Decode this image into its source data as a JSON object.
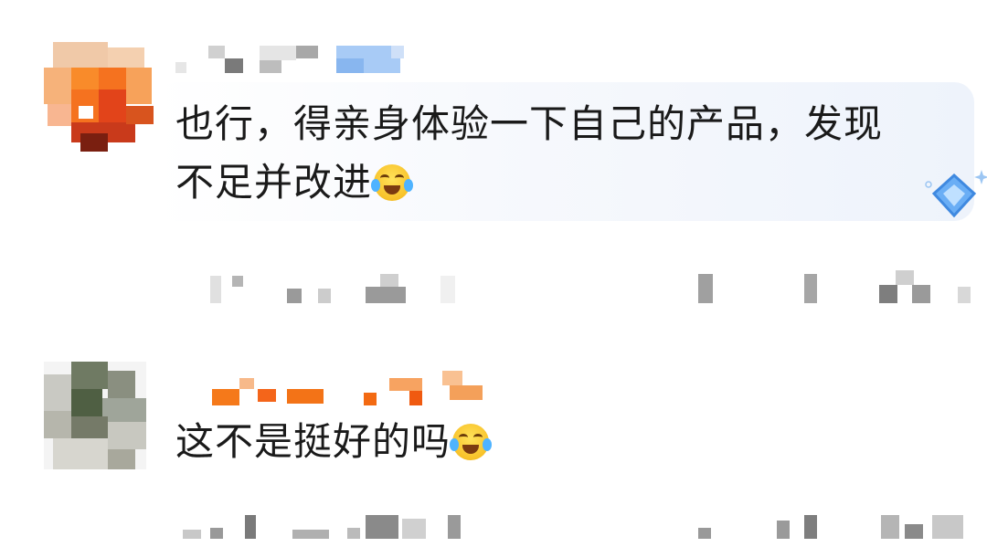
{
  "comments": [
    {
      "text_line1": "也行，得亲身体验一下自己的产品，发现",
      "text_line2": "不足并改进",
      "emoji": "crying-laughing-emoji"
    },
    {
      "text_line1": "这不是挺好的吗",
      "emoji": "crying-laughing-emoji"
    }
  ],
  "colors": {
    "bubble_bg": "#eef3fb",
    "text": "#1a1a1a",
    "badge": "#5aa8f5"
  }
}
